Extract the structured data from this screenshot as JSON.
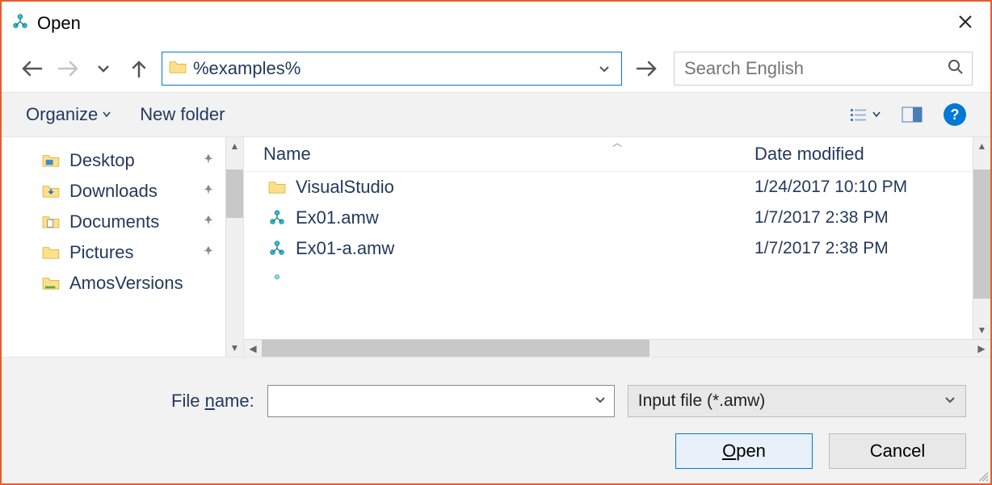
{
  "titlebar": {
    "title": "Open"
  },
  "nav": {
    "path": "%examples%",
    "search_placeholder": "Search English"
  },
  "toolbar": {
    "organize": "Organize",
    "new_folder": "New folder"
  },
  "sidebar": {
    "items": [
      {
        "label": "Desktop"
      },
      {
        "label": "Downloads"
      },
      {
        "label": "Documents"
      },
      {
        "label": "Pictures"
      },
      {
        "label": "AmosVersions"
      }
    ]
  },
  "filelist": {
    "columns": {
      "name": "Name",
      "date": "Date modified"
    },
    "rows": [
      {
        "type": "folder",
        "name": "VisualStudio",
        "date": "1/24/2017 10:10 PM"
      },
      {
        "type": "amw",
        "name": "Ex01.amw",
        "date": "1/7/2017 2:38 PM"
      },
      {
        "type": "amw",
        "name": "Ex01-a.amw",
        "date": "1/7/2017 2:38 PM"
      }
    ]
  },
  "bottom": {
    "file_name_label_prefix": "File ",
    "file_name_label_ul": "n",
    "file_name_label_suffix": "ame:",
    "file_name_value": "",
    "filter": "Input file (*.amw)",
    "open_ul": "O",
    "open_rest": "pen",
    "cancel": "Cancel"
  }
}
